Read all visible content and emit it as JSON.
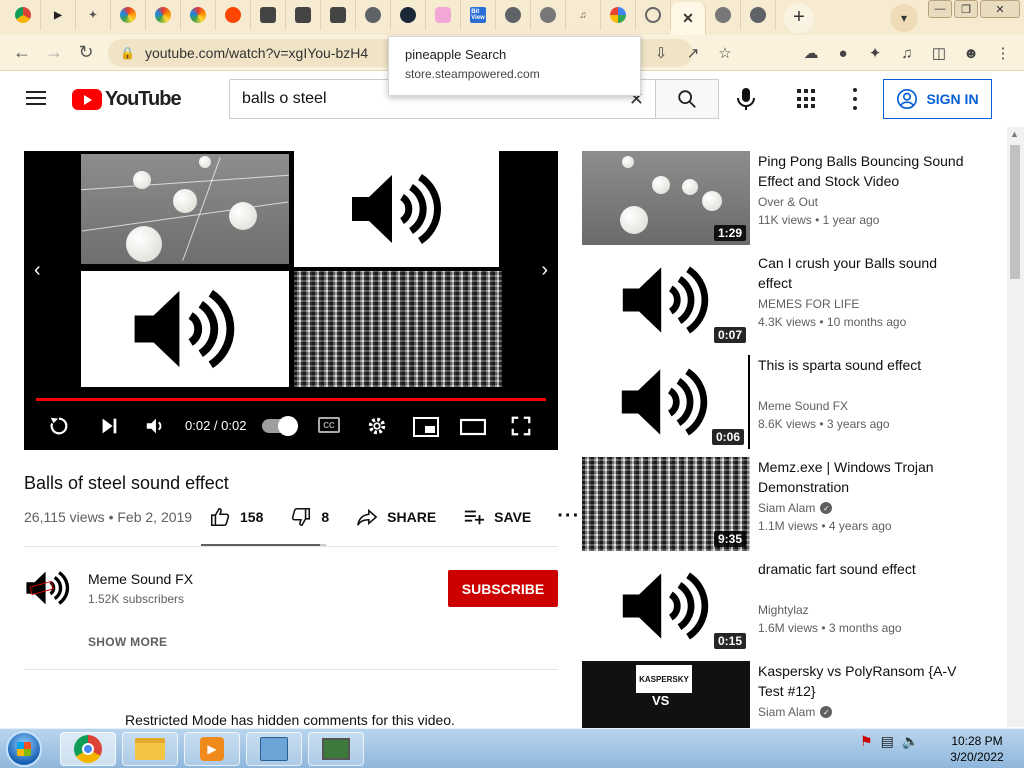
{
  "browser": {
    "tabs": [
      {
        "icon": "chrome-logo-icon",
        "active": false
      },
      {
        "icon": "cursor-icon",
        "active": false
      },
      {
        "icon": "puzzle-icon",
        "active": false
      },
      {
        "icon": "rainbow-icon",
        "active": false
      },
      {
        "icon": "rainbow-icon",
        "active": false
      },
      {
        "icon": "rainbow-icon",
        "active": false
      },
      {
        "icon": "reddit-icon",
        "active": false
      },
      {
        "icon": "skull-icon",
        "active": false
      },
      {
        "icon": "skull-icon",
        "active": false
      },
      {
        "icon": "skull-icon",
        "active": false
      },
      {
        "icon": "chromium-icon",
        "active": false
      },
      {
        "icon": "steam-icon",
        "active": false
      },
      {
        "icon": "pink-character-icon",
        "active": false
      },
      {
        "icon": "bitview-icon",
        "active": false
      },
      {
        "icon": "chromium-icon",
        "active": false
      },
      {
        "icon": "globe-icon",
        "active": false
      },
      {
        "icon": "audio-icon",
        "active": false
      },
      {
        "icon": "google-icon",
        "active": false
      },
      {
        "icon": "history-icon",
        "active": false
      },
      {
        "icon": "close-icon",
        "active": true
      },
      {
        "icon": "globe-icon",
        "active": false
      },
      {
        "icon": "chromium-icon",
        "active": false
      }
    ],
    "bitview_label": "Bit\nView",
    "address": "youtube.com/watch?v=xgIYou-bzH4",
    "popup": {
      "title": "pineapple Search",
      "url": "store.steampowered.com"
    }
  },
  "youtube": {
    "logo_text": "YouTube",
    "search_value": "balls o steel",
    "signin_label": "SIGN IN",
    "player": {
      "time": "0:02 / 0:02",
      "progress": 1.0
    },
    "video": {
      "title": "Balls of steel sound effect",
      "meta": "26,115 views • Feb 2, 2019",
      "likes": "158",
      "dislikes": "8",
      "share_label": "SHARE",
      "save_label": "SAVE",
      "like_ratio": 0.95
    },
    "channel": {
      "name": "Meme Sound FX",
      "subscribers": "1.52K subscribers",
      "subscribe_label": "SUBSCRIBE",
      "show_more_label": "SHOW MORE"
    },
    "restricted_notice": "Restricted Mode has hidden comments for this video.",
    "recommendations": [
      {
        "title": "Ping Pong Balls Bouncing Sound Effect and Stock Video",
        "channel": "Over & Out",
        "verified": false,
        "views": "11K views • 1 year ago",
        "duration": "1:29",
        "thumb": "balls"
      },
      {
        "title": "Can I crush your Balls sound effect",
        "channel": "MEMES FOR LIFE",
        "verified": false,
        "views": "4.3K views • 10 months ago",
        "duration": "0:07",
        "thumb": "speaker"
      },
      {
        "title": "This is sparta sound effect",
        "channel": "Meme Sound FX",
        "verified": false,
        "views": "8.6K views • 3 years ago",
        "duration": "0:06",
        "thumb": "speaker"
      },
      {
        "title": "Memz.exe | Windows Trojan Demonstration",
        "channel": "Siam Alam",
        "verified": true,
        "views": "1.1M views • 4 years ago",
        "duration": "9:35",
        "thumb": "memz"
      },
      {
        "title": "dramatic fart sound effect",
        "channel": "Mightylaz",
        "verified": false,
        "views": "1.6M views • 3 months ago",
        "duration": "0:15",
        "thumb": "speaker"
      },
      {
        "title": "Kaspersky vs PolyRansom {A-V Test #12}",
        "channel": "Siam Alam",
        "verified": true,
        "views": "",
        "duration": "",
        "thumb": "kasp",
        "thumb_text_1": "KASPERSKY",
        "thumb_text_2": "VS"
      }
    ]
  },
  "taskbar": {
    "time": "10:28 PM",
    "date": "3/20/2022"
  }
}
